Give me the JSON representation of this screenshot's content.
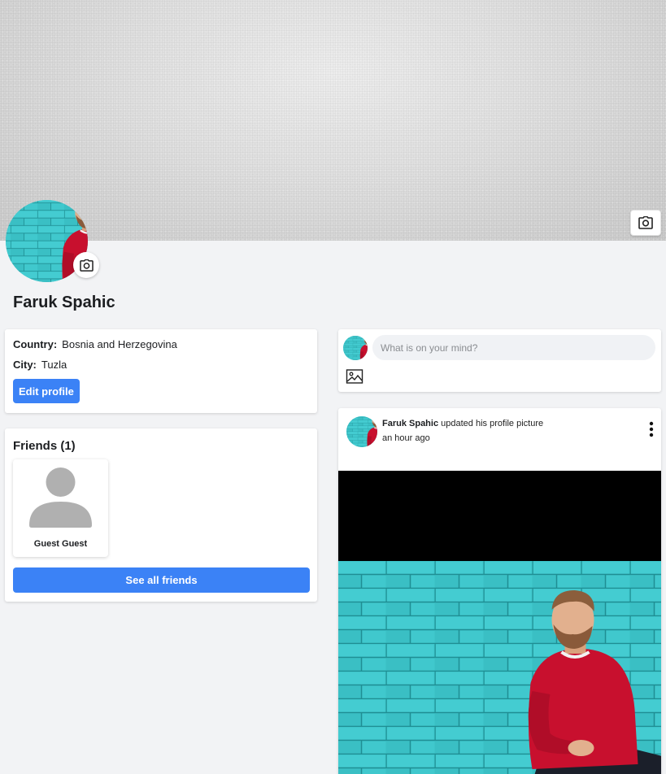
{
  "profile": {
    "name": "Faruk Spahic"
  },
  "info": {
    "country_label": "Country:",
    "country_value": "Bosnia and Herzegovina",
    "city_label": "City:",
    "city_value": "Tuzla",
    "edit_button": "Edit profile"
  },
  "friends": {
    "title": "Friends (1)",
    "items": [
      {
        "name": "Guest Guest"
      }
    ],
    "see_all_button": "See all friends"
  },
  "composer": {
    "placeholder": "What is on your mind?"
  },
  "post": {
    "author": "Faruk Spahic",
    "action": "updated his profile picture",
    "time": "an hour ago"
  },
  "colors": {
    "primary": "#3b82f6",
    "background": "#f2f3f5",
    "brick": "#3fc7cc",
    "sweater": "#c8102e"
  },
  "icons": {
    "cover_camera": "camera-icon",
    "avatar_camera": "camera-icon",
    "composer_image": "image-icon",
    "post_menu": "more-vertical-icon",
    "friend_placeholder": "user-silhouette-icon"
  }
}
